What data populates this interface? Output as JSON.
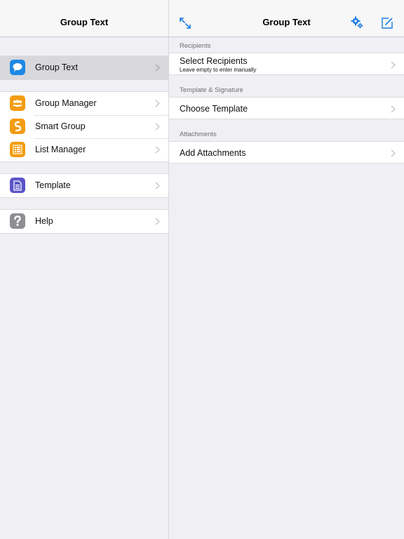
{
  "master": {
    "title": "Group Text",
    "groups": [
      [
        {
          "label": "Group Text",
          "icon": "speech-bubble-icon",
          "color": "#1e88e5",
          "selected": true
        }
      ],
      [
        {
          "label": "Group Manager",
          "icon": "people-icon",
          "color": "#f39c12",
          "selected": false
        },
        {
          "label": "Smart Group",
          "icon": "smart-group-icon",
          "color": "#f39c12",
          "selected": false
        },
        {
          "label": "List Manager",
          "icon": "list-icon",
          "color": "#f39c12",
          "selected": false
        }
      ],
      [
        {
          "label": "Template",
          "icon": "document-icon",
          "color": "#5b54c9",
          "selected": false
        }
      ],
      [
        {
          "label": "Help",
          "icon": "question-mark-icon",
          "color": "#8e8e93",
          "selected": false
        }
      ]
    ]
  },
  "detail": {
    "title": "Group Text",
    "accent_color": "#1a7de0",
    "buttons": {
      "expand": "expand-arrows-icon",
      "settings": "gear-icon",
      "compose": "compose-icon"
    },
    "sections": [
      {
        "header": "Recipients",
        "row_label": "Select Recipients",
        "row_sublabel": "Leave empty to enter manually"
      },
      {
        "header": "Template & Signature",
        "row_label": "Choose Template",
        "row_sublabel": ""
      },
      {
        "header": "Attachments",
        "row_label": "Add Attachments",
        "row_sublabel": ""
      }
    ]
  }
}
